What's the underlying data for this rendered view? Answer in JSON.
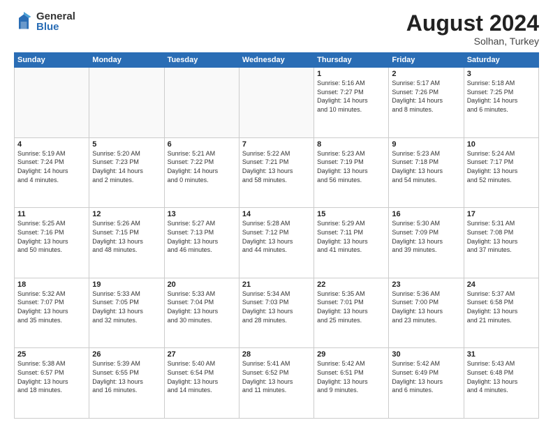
{
  "logo": {
    "general": "General",
    "blue": "Blue"
  },
  "title": "August 2024",
  "subtitle": "Solhan, Turkey",
  "headers": [
    "Sunday",
    "Monday",
    "Tuesday",
    "Wednesday",
    "Thursday",
    "Friday",
    "Saturday"
  ],
  "weeks": [
    [
      {
        "day": "",
        "info": ""
      },
      {
        "day": "",
        "info": ""
      },
      {
        "day": "",
        "info": ""
      },
      {
        "day": "",
        "info": ""
      },
      {
        "day": "1",
        "info": "Sunrise: 5:16 AM\nSunset: 7:27 PM\nDaylight: 14 hours\nand 10 minutes."
      },
      {
        "day": "2",
        "info": "Sunrise: 5:17 AM\nSunset: 7:26 PM\nDaylight: 14 hours\nand 8 minutes."
      },
      {
        "day": "3",
        "info": "Sunrise: 5:18 AM\nSunset: 7:25 PM\nDaylight: 14 hours\nand 6 minutes."
      }
    ],
    [
      {
        "day": "4",
        "info": "Sunrise: 5:19 AM\nSunset: 7:24 PM\nDaylight: 14 hours\nand 4 minutes."
      },
      {
        "day": "5",
        "info": "Sunrise: 5:20 AM\nSunset: 7:23 PM\nDaylight: 14 hours\nand 2 minutes."
      },
      {
        "day": "6",
        "info": "Sunrise: 5:21 AM\nSunset: 7:22 PM\nDaylight: 14 hours\nand 0 minutes."
      },
      {
        "day": "7",
        "info": "Sunrise: 5:22 AM\nSunset: 7:21 PM\nDaylight: 13 hours\nand 58 minutes."
      },
      {
        "day": "8",
        "info": "Sunrise: 5:23 AM\nSunset: 7:19 PM\nDaylight: 13 hours\nand 56 minutes."
      },
      {
        "day": "9",
        "info": "Sunrise: 5:23 AM\nSunset: 7:18 PM\nDaylight: 13 hours\nand 54 minutes."
      },
      {
        "day": "10",
        "info": "Sunrise: 5:24 AM\nSunset: 7:17 PM\nDaylight: 13 hours\nand 52 minutes."
      }
    ],
    [
      {
        "day": "11",
        "info": "Sunrise: 5:25 AM\nSunset: 7:16 PM\nDaylight: 13 hours\nand 50 minutes."
      },
      {
        "day": "12",
        "info": "Sunrise: 5:26 AM\nSunset: 7:15 PM\nDaylight: 13 hours\nand 48 minutes."
      },
      {
        "day": "13",
        "info": "Sunrise: 5:27 AM\nSunset: 7:13 PM\nDaylight: 13 hours\nand 46 minutes."
      },
      {
        "day": "14",
        "info": "Sunrise: 5:28 AM\nSunset: 7:12 PM\nDaylight: 13 hours\nand 44 minutes."
      },
      {
        "day": "15",
        "info": "Sunrise: 5:29 AM\nSunset: 7:11 PM\nDaylight: 13 hours\nand 41 minutes."
      },
      {
        "day": "16",
        "info": "Sunrise: 5:30 AM\nSunset: 7:09 PM\nDaylight: 13 hours\nand 39 minutes."
      },
      {
        "day": "17",
        "info": "Sunrise: 5:31 AM\nSunset: 7:08 PM\nDaylight: 13 hours\nand 37 minutes."
      }
    ],
    [
      {
        "day": "18",
        "info": "Sunrise: 5:32 AM\nSunset: 7:07 PM\nDaylight: 13 hours\nand 35 minutes."
      },
      {
        "day": "19",
        "info": "Sunrise: 5:33 AM\nSunset: 7:05 PM\nDaylight: 13 hours\nand 32 minutes."
      },
      {
        "day": "20",
        "info": "Sunrise: 5:33 AM\nSunset: 7:04 PM\nDaylight: 13 hours\nand 30 minutes."
      },
      {
        "day": "21",
        "info": "Sunrise: 5:34 AM\nSunset: 7:03 PM\nDaylight: 13 hours\nand 28 minutes."
      },
      {
        "day": "22",
        "info": "Sunrise: 5:35 AM\nSunset: 7:01 PM\nDaylight: 13 hours\nand 25 minutes."
      },
      {
        "day": "23",
        "info": "Sunrise: 5:36 AM\nSunset: 7:00 PM\nDaylight: 13 hours\nand 23 minutes."
      },
      {
        "day": "24",
        "info": "Sunrise: 5:37 AM\nSunset: 6:58 PM\nDaylight: 13 hours\nand 21 minutes."
      }
    ],
    [
      {
        "day": "25",
        "info": "Sunrise: 5:38 AM\nSunset: 6:57 PM\nDaylight: 13 hours\nand 18 minutes."
      },
      {
        "day": "26",
        "info": "Sunrise: 5:39 AM\nSunset: 6:55 PM\nDaylight: 13 hours\nand 16 minutes."
      },
      {
        "day": "27",
        "info": "Sunrise: 5:40 AM\nSunset: 6:54 PM\nDaylight: 13 hours\nand 14 minutes."
      },
      {
        "day": "28",
        "info": "Sunrise: 5:41 AM\nSunset: 6:52 PM\nDaylight: 13 hours\nand 11 minutes."
      },
      {
        "day": "29",
        "info": "Sunrise: 5:42 AM\nSunset: 6:51 PM\nDaylight: 13 hours\nand 9 minutes."
      },
      {
        "day": "30",
        "info": "Sunrise: 5:42 AM\nSunset: 6:49 PM\nDaylight: 13 hours\nand 6 minutes."
      },
      {
        "day": "31",
        "info": "Sunrise: 5:43 AM\nSunset: 6:48 PM\nDaylight: 13 hours\nand 4 minutes."
      }
    ]
  ]
}
